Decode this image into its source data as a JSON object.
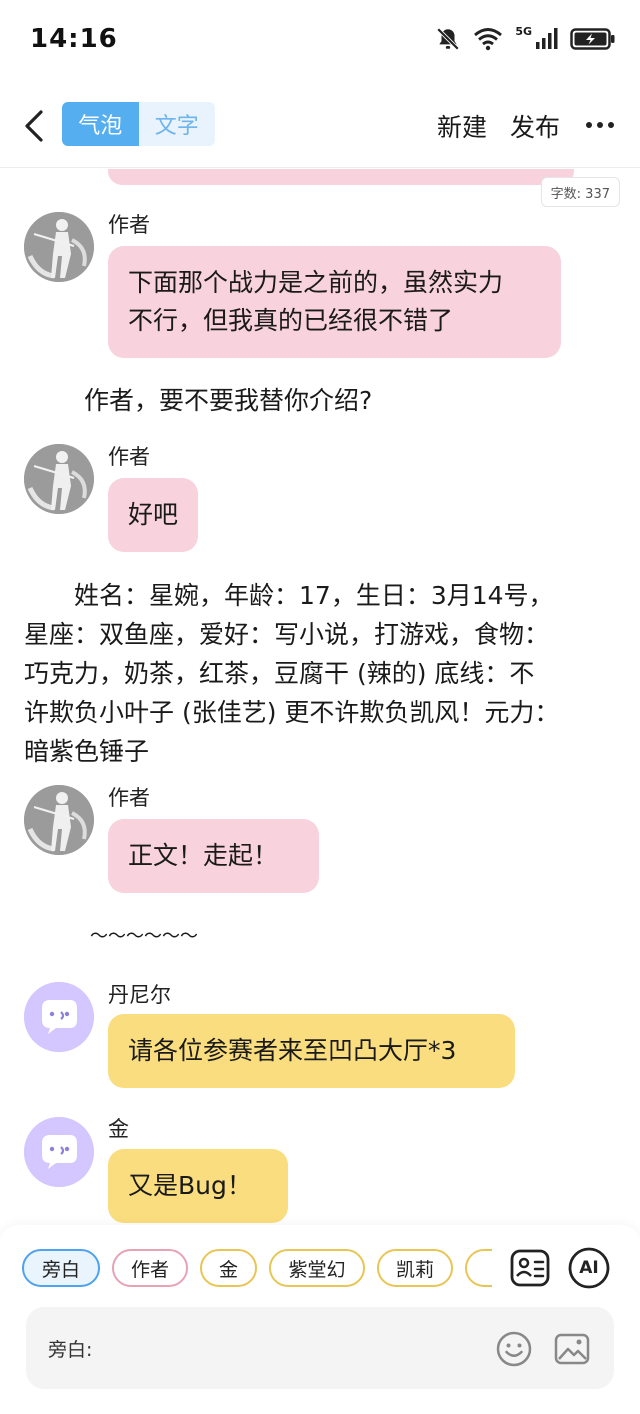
{
  "status_bar": {
    "time": "14:16",
    "network": "5G",
    "icons": [
      "bell-off-icon",
      "wifi-icon",
      "signal-icon",
      "battery-charging-icon"
    ]
  },
  "header": {
    "back_icon": "chevron-left-icon",
    "mode_tabs": [
      {
        "label": "气泡",
        "active": true
      },
      {
        "label": "文字",
        "active": false
      }
    ],
    "new_label": "新建",
    "publish_label": "发布",
    "more_icon": "more-horizontal-icon"
  },
  "word_count": "字数: 337",
  "messages": [
    {
      "type": "bubble",
      "sender": "作者",
      "avatar": "author-avatar",
      "color": "#f8d2dc",
      "text_lines": [
        "下面那个战力是之前的，虽然实力",
        "不行，但我真的已经很不错了"
      ]
    },
    {
      "type": "narration",
      "text": "作者，要不要我替你介绍?"
    },
    {
      "type": "bubble",
      "sender": "作者",
      "avatar": "author-avatar",
      "color": "#f8d2dc",
      "text": "好吧"
    },
    {
      "type": "narration",
      "text_lines": [
        "　　姓名：星婉，年龄：17，生日：3月14号，",
        "星座：双鱼座，爱好：写小说，打游戏，食物：",
        "巧克力，奶茶，红茶，豆腐干 (辣的) 底线：不",
        "许欺负小叶子 (张佳艺) 更不许欺负凯风！元力：",
        "暗紫色锤子"
      ]
    },
    {
      "type": "bubble",
      "sender": "作者",
      "avatar": "author-avatar",
      "color": "#f8d2dc",
      "text": "正文！走起！"
    },
    {
      "type": "narration",
      "text": "～～～～～～"
    },
    {
      "type": "bubble",
      "sender": "丹尼尔",
      "avatar": "chat-bot-avatar",
      "color": "#f9dd7e",
      "text": "请各位参赛者来至凹凸大厅*3"
    },
    {
      "type": "bubble",
      "sender": "金",
      "avatar": "chat-bot-avatar",
      "color": "#f9dd7e",
      "text": "又是Bug！"
    }
  ],
  "role_chips": [
    {
      "label": "旁白",
      "style": "selected"
    },
    {
      "label": "作者",
      "style": "pink"
    },
    {
      "label": "金",
      "style": "yellow"
    },
    {
      "label": "紫堂幻",
      "style": "yellow"
    },
    {
      "label": "凯莉",
      "style": "yellow"
    },
    {
      "label": "",
      "style": "yellow"
    }
  ],
  "tools": {
    "role_card_icon": "contact-card-icon",
    "ai_label": "AI"
  },
  "input": {
    "prefix": "旁白:",
    "placeholder": "",
    "emoji_icon": "smiley-icon",
    "image_icon": "image-icon"
  }
}
